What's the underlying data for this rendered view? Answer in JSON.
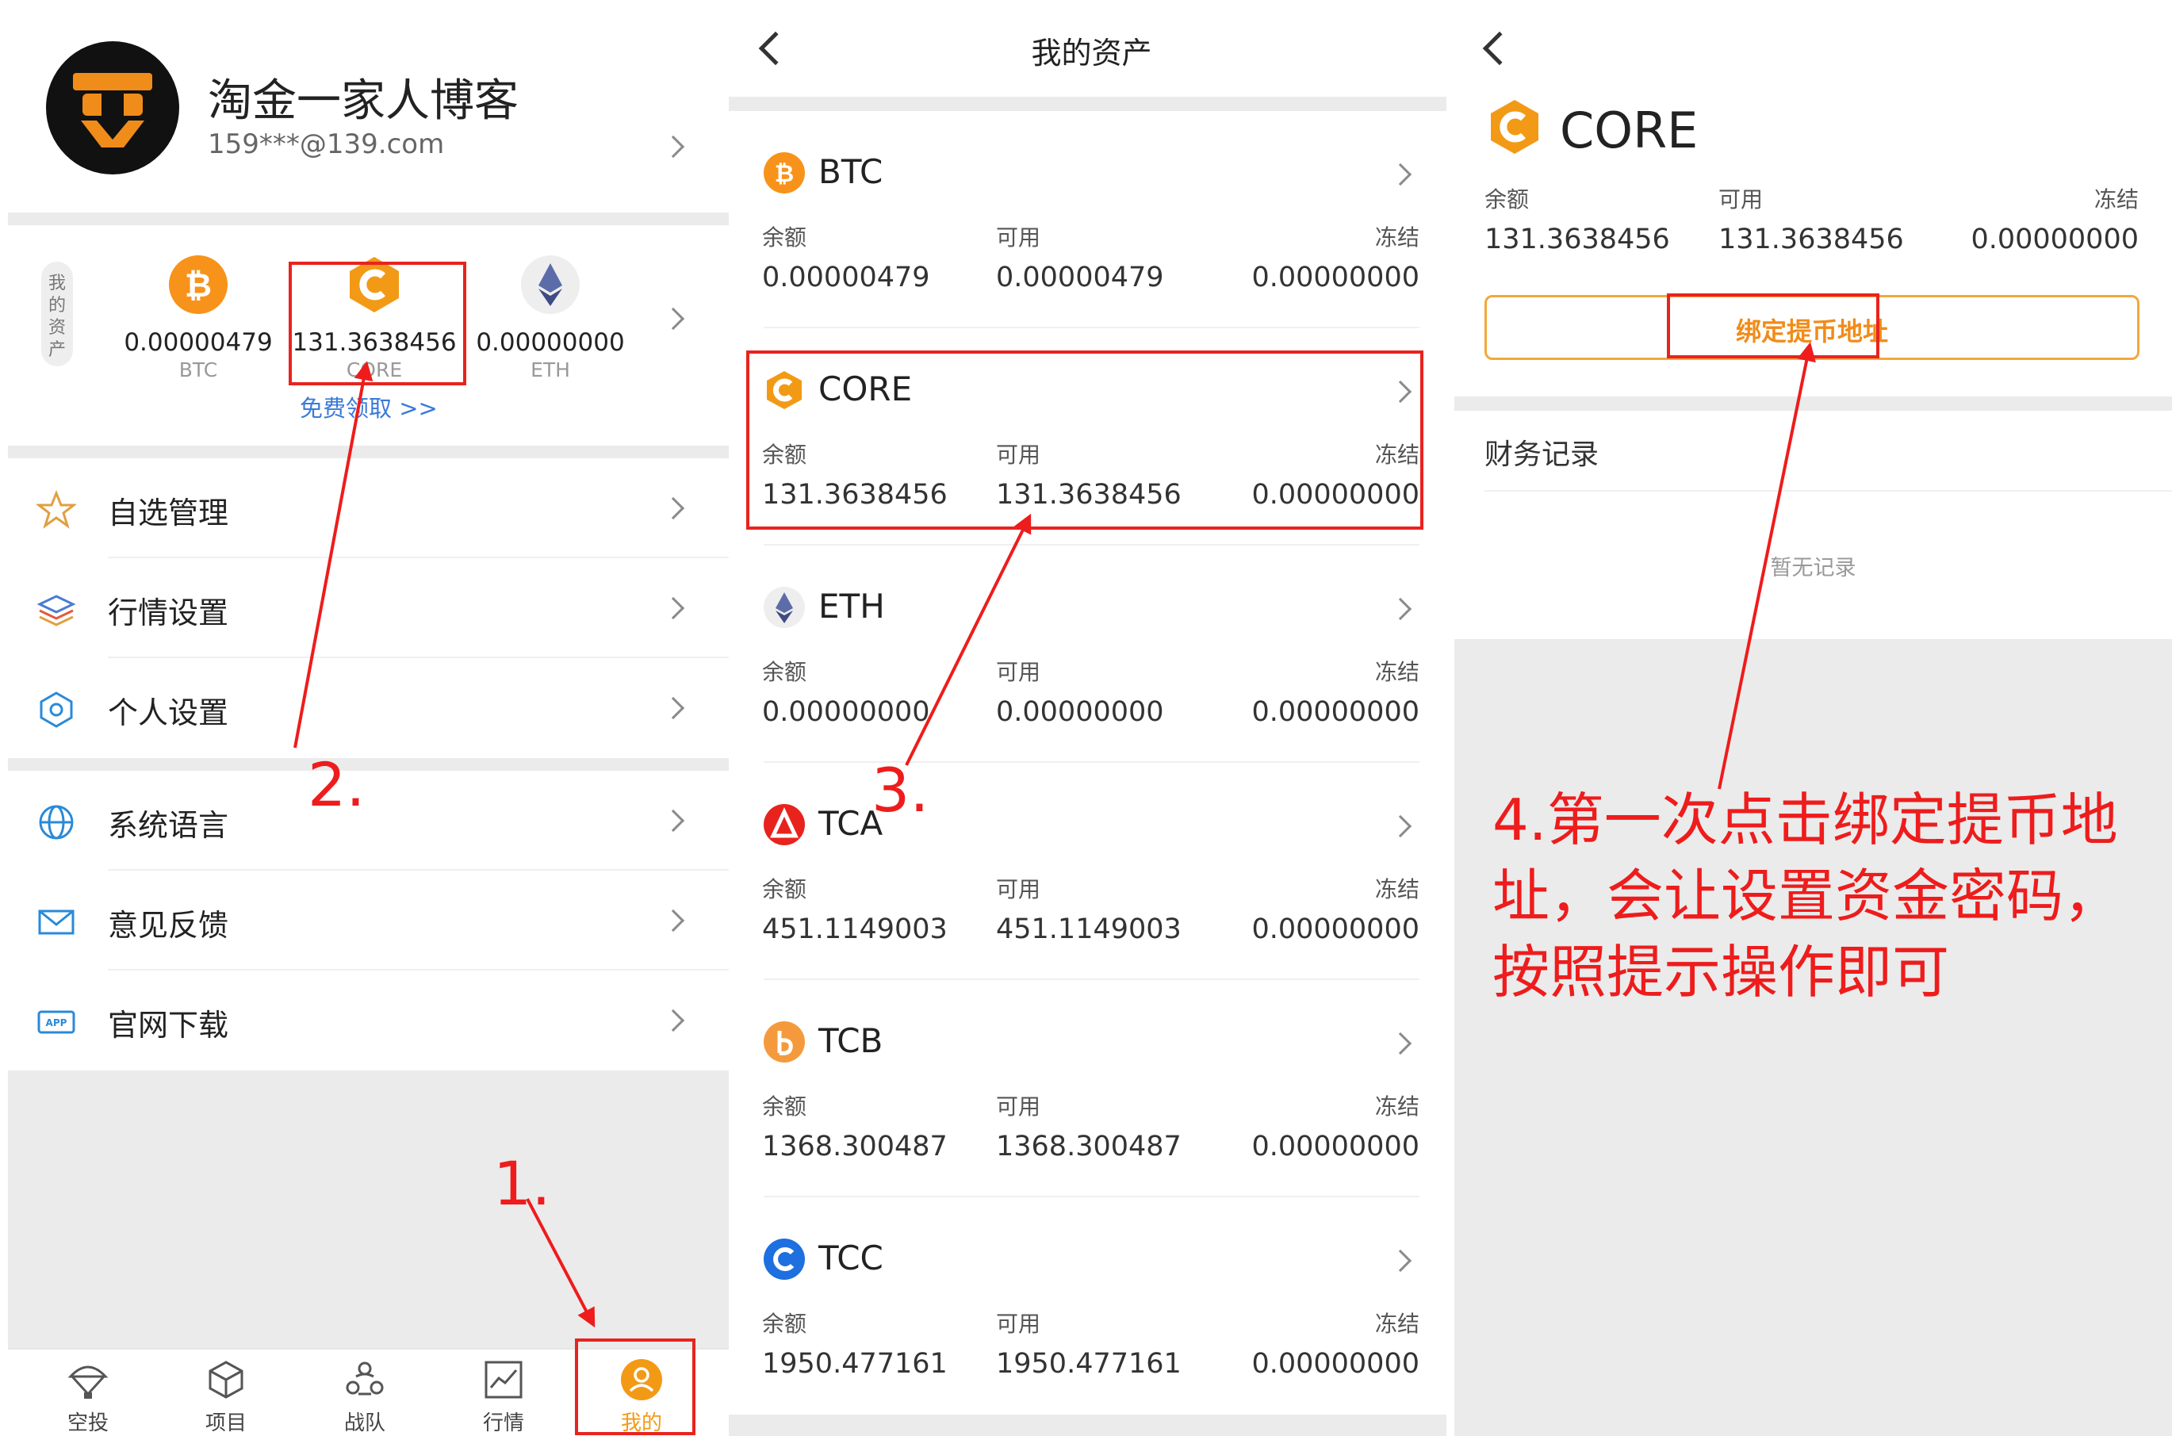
{
  "profile": {
    "name": "淘金一家人博客",
    "email": "159***@139.com",
    "assets_tag": "我的资产",
    "free_link": "免费领取 >>",
    "assets": [
      {
        "amount": "0.00000479",
        "symbol": "BTC"
      },
      {
        "amount": "131.3638456",
        "symbol": "CORE"
      },
      {
        "amount": "0.00000000",
        "symbol": "ETH"
      }
    ],
    "menu": [
      {
        "label": "自选管理",
        "icon": "star-icon"
      },
      {
        "label": "行情设置",
        "icon": "layers-icon"
      },
      {
        "label": "个人设置",
        "icon": "hexagon-settings-icon"
      },
      {
        "label": "系统语言",
        "icon": "globe-icon"
      },
      {
        "label": "意见反馈",
        "icon": "mail-icon"
      },
      {
        "label": "官网下载",
        "icon": "app-download-icon"
      }
    ],
    "tabs": [
      {
        "label": "空投",
        "icon": "parachute-icon"
      },
      {
        "label": "项目",
        "icon": "cube-icon"
      },
      {
        "label": "战队",
        "icon": "team-icon"
      },
      {
        "label": "行情",
        "icon": "chart-icon"
      },
      {
        "label": "我的",
        "icon": "user-icon",
        "active": true
      }
    ]
  },
  "my_assets": {
    "title": "我的资产",
    "labels": {
      "balance": "余额",
      "available": "可用",
      "frozen": "冻结"
    },
    "coins": [
      {
        "symbol": "BTC",
        "balance": "0.00000479",
        "available": "0.00000479",
        "frozen": "0.00000000",
        "color": "#f7931a"
      },
      {
        "symbol": "CORE",
        "balance": "131.3638456",
        "available": "131.3638456",
        "frozen": "0.00000000",
        "color": "#f29a16"
      },
      {
        "symbol": "ETH",
        "balance": "0.00000000",
        "available": "0.00000000",
        "frozen": "0.00000000",
        "color": "#627eea"
      },
      {
        "symbol": "TCA",
        "balance": "451.1149003",
        "available": "451.1149003",
        "frozen": "0.00000000",
        "color": "#e8231e"
      },
      {
        "symbol": "TCB",
        "balance": "1368.300487",
        "available": "1368.300487",
        "frozen": "0.00000000",
        "color": "#f59a3c"
      },
      {
        "symbol": "TCC",
        "balance": "1950.477161",
        "available": "1950.477161",
        "frozen": "0.00000000",
        "color": "#1e6fe0"
      }
    ]
  },
  "core_detail": {
    "coin": "CORE",
    "labels": {
      "balance": "余额",
      "available": "可用",
      "frozen": "冻结"
    },
    "balance": "131.3638456",
    "available": "131.3638456",
    "frozen": "0.00000000",
    "bind_button": "绑定提币地址",
    "records_title": "财务记录",
    "empty_text": "暂无记录"
  },
  "annotations": {
    "step1": "1.",
    "step2": "2.",
    "step3": "3.",
    "step4_line1": "4.第一次点击绑定提币地",
    "step4_line2": "址，会让设置资金密码，",
    "step4_line3": "按照提示操作即可",
    "color": "#ee1c1c"
  }
}
